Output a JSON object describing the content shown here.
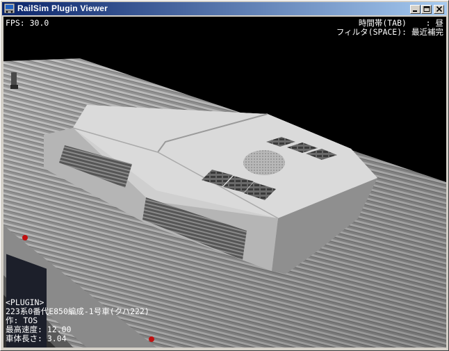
{
  "window": {
    "title": "RailSim Plugin Viewer"
  },
  "hud": {
    "fps": "FPS: 30.0",
    "time_zone": "時間帯(TAB)    : 昼",
    "filter": "フィルタ(SPACE): 最近補完"
  },
  "plugin_info": {
    "header": "<PLUGIN>",
    "name": "223系0番代E850編成-1号車(クハ222)",
    "author": "作: TOS",
    "max_speed": "最高速度: 12.00",
    "body_length": "車体長さ: 3.04"
  },
  "icons": {
    "app": "railsim-app-icon",
    "minimize": "minimize-icon",
    "maximize": "maximize-icon",
    "close": "close-icon"
  },
  "colors": {
    "titlebar_start": "#0a246a",
    "titlebar_end": "#a6caf0",
    "viewport_bg": "#000000",
    "hud_text": "#ffffff"
  }
}
